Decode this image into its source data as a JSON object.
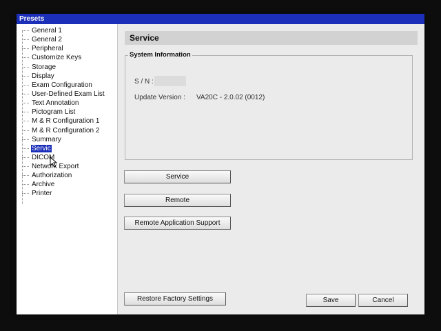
{
  "window": {
    "title": "Presets"
  },
  "sidebar": {
    "items": [
      {
        "label": "General 1"
      },
      {
        "label": "General 2"
      },
      {
        "label": "Peripheral"
      },
      {
        "label": "Customize Keys"
      },
      {
        "label": "Storage"
      },
      {
        "label": "Display"
      },
      {
        "label": "Exam Configuration"
      },
      {
        "label": "User-Defined Exam List"
      },
      {
        "label": "Text Annotation"
      },
      {
        "label": "Pictogram List"
      },
      {
        "label": "M & R Configuration 1"
      },
      {
        "label": "M & R Configuration 2"
      },
      {
        "label": "Summary"
      },
      {
        "label": "Servic",
        "selected": true
      },
      {
        "label": "DICOM"
      },
      {
        "label": "Network Export"
      },
      {
        "label": "Authorization"
      },
      {
        "label": "Archive"
      },
      {
        "label": "Printer"
      }
    ]
  },
  "main": {
    "title": "Service",
    "system_info": {
      "legend": "System Information",
      "sn_label": "S / N :",
      "update_label": "Update Version :",
      "update_value": "VA20C - 2.0.02 (0012)"
    },
    "buttons": {
      "service": "Service",
      "remote": "Remote",
      "remote_app_support": "Remote Application Support"
    }
  },
  "footer": {
    "restore": "Restore Factory Settings",
    "save": "Save",
    "cancel": "Cancel"
  },
  "colors": {
    "title_bar": "#1c2fb8",
    "selection": "#1c2fb8",
    "panel": "#ebebeb"
  }
}
